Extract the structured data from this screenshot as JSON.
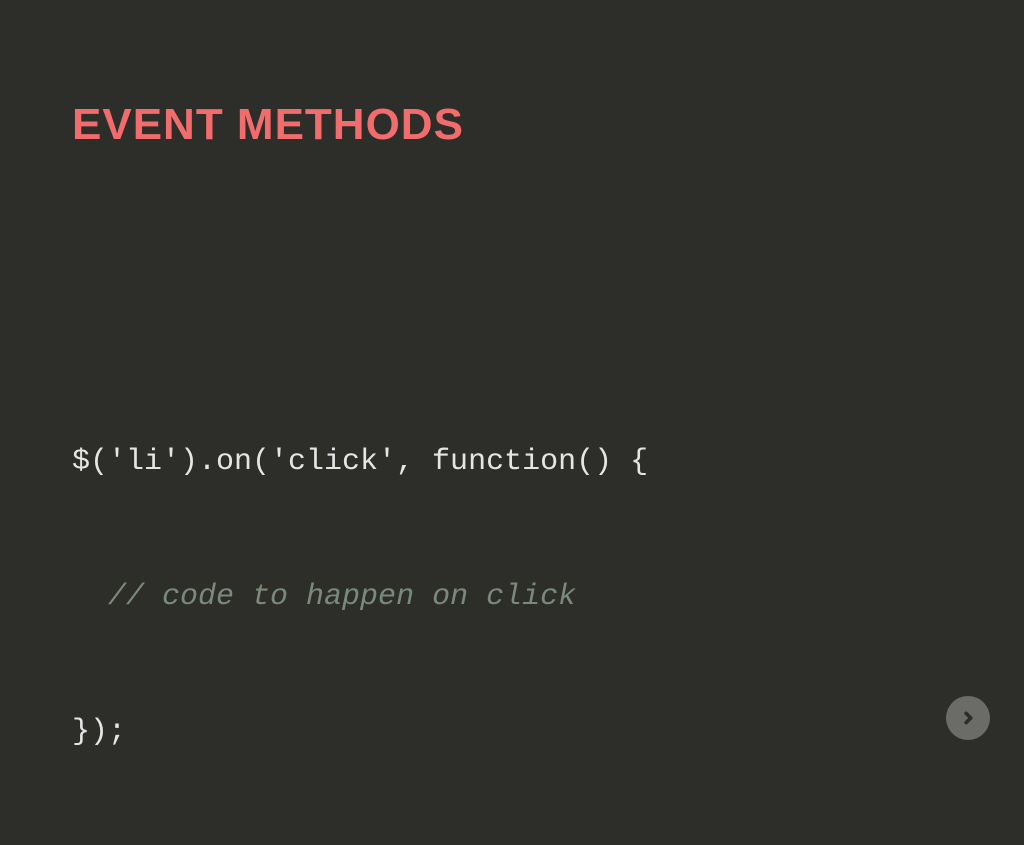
{
  "slide": {
    "title": "EVENT METHODS",
    "code": {
      "line1": "$('li').on('click', function() {",
      "line2_indent": "  ",
      "line2_comment": "// code to happen on click",
      "line3": "});"
    }
  },
  "nav": {
    "next_icon": "arrow-right"
  },
  "colors": {
    "background": "#2d2d2a",
    "title": "#f16c6c",
    "code_text": "#e5e5e5",
    "code_comment": "#7a8a7a",
    "button_bg": "#6b6b68"
  }
}
